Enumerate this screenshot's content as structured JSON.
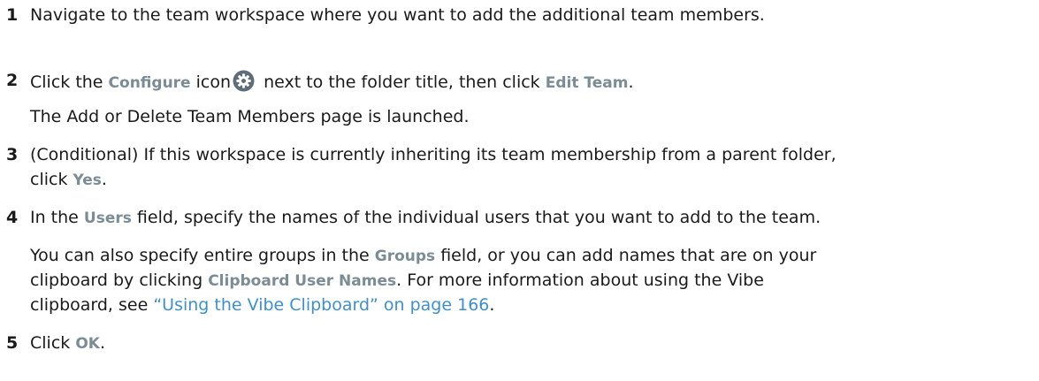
{
  "steps": [
    {
      "number": "1",
      "text": "Navigate to the team workspace where you want to add the additional team members."
    },
    {
      "number": "2",
      "t1": "Click the ",
      "ui1": "Configure",
      "t2": " icon",
      "icon": "gear-icon",
      "t3": " next to the folder title, then click ",
      "ui2": "Edit Team",
      "t4": ".",
      "sub": "The Add or Delete Team Members page is launched."
    },
    {
      "number": "3",
      "line1": "(Conditional) If this workspace is currently inheriting its team membership from a parent folder,",
      "t1": "click ",
      "ui1": "Yes",
      "t2": "."
    },
    {
      "number": "4",
      "t1": "In the ",
      "ui1": "Users",
      "t2": " field, specify the names of the individual users that you want to add to the team.",
      "p1": "You can also specify entire groups in the ",
      "pui1": "Groups",
      "p2": " field, or you can add names that are on your",
      "p3": "clipboard by clicking ",
      "pui2": "Clipboard User Names",
      "p4": ". For more information about using the Vibe",
      "p5": "clipboard, see ",
      "plink": "“Using the Vibe Clipboard” on page 166",
      "p6": "."
    },
    {
      "number": "5",
      "t1": "Click ",
      "ui1": "OK",
      "t2": "."
    }
  ],
  "colors": {
    "ui_term": "#7a8c96",
    "link": "#3d8fd0",
    "text": "#1a1a1a"
  }
}
